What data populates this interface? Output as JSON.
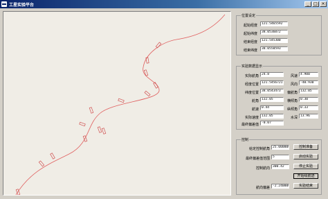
{
  "window": {
    "title": "工星实验平台",
    "min": "_",
    "max": "□",
    "close": "×"
  },
  "position_settings": {
    "title": "位置设定",
    "rows": [
      {
        "label": "起始经度",
        "value": "121.5465592"
      },
      {
        "label": "起始纬度",
        "value": "38.0536072"
      },
      {
        "label": "结束经度",
        "value": "121.545300"
      },
      {
        "label": "结束纬度",
        "value": "38.0550593"
      }
    ]
  },
  "realtime": {
    "title": "实验数据显示",
    "rows": [
      {
        "l1": "实际航角",
        "v1": "24.8",
        "l2": "风速",
        "v2": "4.900"
      },
      {
        "l1": "经度位置",
        "v1": "121.5456721",
        "l2": "风向",
        "v2": "-40.930"
      },
      {
        "l1": "纬度位置",
        "v1": "38.0543473",
        "l2": "偏航角",
        "v2": "132.05"
      },
      {
        "l1": "舵角",
        "v1": "132.05",
        "l2": "横倾角",
        "v2": "0.30"
      },
      {
        "l1": "航速",
        "v1": "0.44",
        "l2": "纵倾角",
        "v2": "0.33"
      },
      {
        "l1": "实际速度",
        "v1": "132.05",
        "l2": "水深",
        "v2": "13.96"
      }
    ],
    "last": {
      "label": "最终偏差值",
      "value": "-0.07"
    }
  },
  "control": {
    "title": "控制",
    "rows": [
      {
        "label": "给定控制航角",
        "value": "25.000000",
        "button": "控制准备",
        "active": false
      },
      {
        "label": "最终偏差值范围",
        "value": "5",
        "button": "启动实验",
        "active": false
      },
      {
        "label": "控制航向",
        "value": "300.42",
        "button": "停止实验",
        "active": false
      },
      {
        "label": "",
        "value": "",
        "button": "开始绘航迹",
        "active": true
      },
      {
        "label": "航向偏差",
        "value": "-2.240000",
        "button": "实验结束",
        "active": false
      }
    ]
  },
  "track": {
    "color": "#e06060",
    "marker_color": "#d05050"
  }
}
